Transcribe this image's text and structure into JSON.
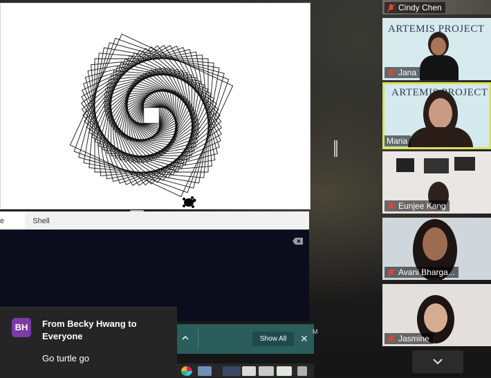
{
  "editor": {
    "tabs": [
      {
        "label": "e",
        "active": true
      },
      {
        "label": "Shell",
        "active": false
      }
    ],
    "shell_clear_icon": "backspace-icon"
  },
  "download_bar": {
    "show_all_label": "Show All",
    "close_label": "✕",
    "expand_icon": "chevron-up-icon"
  },
  "clock_fragment": "M",
  "chat_notification": {
    "avatar_initials": "BH",
    "title": "From Becky Hwang to Everyone",
    "message": "Go turtle go",
    "avatar_color": "#7b3aa6"
  },
  "participants": [
    {
      "name": "Cindy Chen",
      "muted": true,
      "speaking": false
    },
    {
      "name": "Jana",
      "muted": true,
      "speaking": false,
      "background_text": "ARTEMIS PROJECT"
    },
    {
      "name": "Maria",
      "muted": false,
      "speaking": true,
      "background_text": "ARTEMIS PROJECT"
    },
    {
      "name": "Eunjee Kang",
      "muted": true,
      "speaking": false
    },
    {
      "name": "Avani Bharga...",
      "muted": true,
      "speaking": false
    },
    {
      "name": "Jasmine",
      "muted": true,
      "speaking": false
    }
  ],
  "gallery": {
    "scroll_down_icon": "chevron-down-icon",
    "speaking_border_color": "#d9e05a"
  },
  "colors": {
    "shell_background": "#0c0d1c",
    "download_bar": "#2a5d5c",
    "muted_mic": "#e0443a"
  }
}
